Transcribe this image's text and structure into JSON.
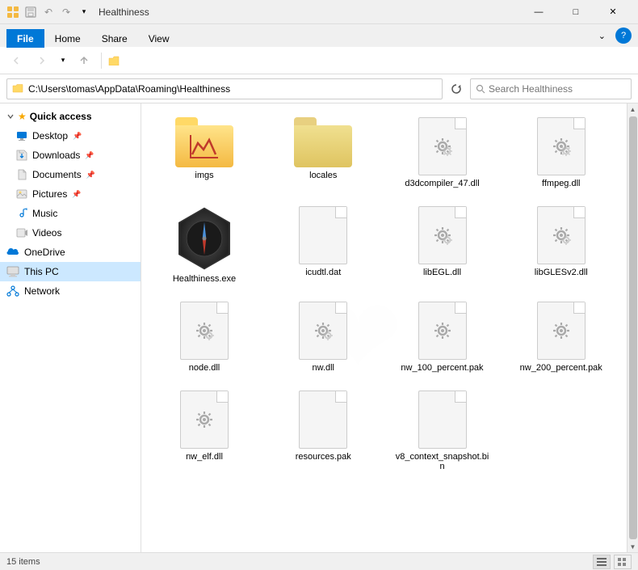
{
  "window": {
    "title": "Healthiness",
    "titlebar_icons": [
      "minimize",
      "maximize",
      "close"
    ]
  },
  "ribbon": {
    "tabs": [
      "File",
      "Home",
      "Share",
      "View"
    ],
    "active_tab": "File"
  },
  "toolbar": {
    "back_label": "←",
    "forward_label": "→",
    "up_label": "↑",
    "recent_label": "▾"
  },
  "address_bar": {
    "path": "C:\\Users\\tomas\\AppData\\Roaming\\Healthiness",
    "refresh_label": "⟳",
    "search_placeholder": "Search Healthiness"
  },
  "sidebar": {
    "sections": [
      {
        "header": "Quick access",
        "items": [
          {
            "label": "Desktop",
            "icon": "desktop",
            "pinned": true
          },
          {
            "label": "Downloads",
            "icon": "downloads",
            "pinned": true
          },
          {
            "label": "Documents",
            "icon": "documents",
            "pinned": true
          },
          {
            "label": "Pictures",
            "icon": "pictures",
            "pinned": true
          },
          {
            "label": "Music",
            "icon": "music",
            "pinned": false
          },
          {
            "label": "Videos",
            "icon": "videos",
            "pinned": false
          }
        ]
      },
      {
        "header": "",
        "items": [
          {
            "label": "OneDrive",
            "icon": "onedrive",
            "pinned": false
          },
          {
            "label": "This PC",
            "icon": "thispc",
            "pinned": false,
            "active": true
          },
          {
            "label": "Network",
            "icon": "network",
            "pinned": false
          }
        ]
      }
    ]
  },
  "files": [
    {
      "name": "imgs",
      "type": "folder-special",
      "icon": "folder-wave"
    },
    {
      "name": "locales",
      "type": "folder",
      "icon": "folder"
    },
    {
      "name": "d3dcompiler_47.dll",
      "type": "dll",
      "icon": "gear"
    },
    {
      "name": "ffmpeg.dll",
      "type": "dll",
      "icon": "gear"
    },
    {
      "name": "Healthiness.exe",
      "type": "exe",
      "icon": "exe"
    },
    {
      "name": "icudtl.dat",
      "type": "dat",
      "icon": "doc"
    },
    {
      "name": "libEGL.dll",
      "type": "dll",
      "icon": "gear"
    },
    {
      "name": "libGLESv2.dll",
      "type": "dll",
      "icon": "gear"
    },
    {
      "name": "node.dll",
      "type": "dll",
      "icon": "gear"
    },
    {
      "name": "nw.dll",
      "type": "dll",
      "icon": "gear"
    },
    {
      "name": "nw_100_percent.pak",
      "type": "pak",
      "icon": "gear"
    },
    {
      "name": "nw_200_percent.pak",
      "type": "pak",
      "icon": "gear"
    },
    {
      "name": "nw_elf.dll",
      "type": "dll",
      "icon": "gear"
    },
    {
      "name": "resources.pak",
      "type": "pak",
      "icon": "doc"
    },
    {
      "name": "v8_context_snapshot.bin",
      "type": "bin",
      "icon": "doc"
    }
  ],
  "status_bar": {
    "item_count": "15 items",
    "view_icons": [
      "list-view",
      "detail-view"
    ]
  }
}
